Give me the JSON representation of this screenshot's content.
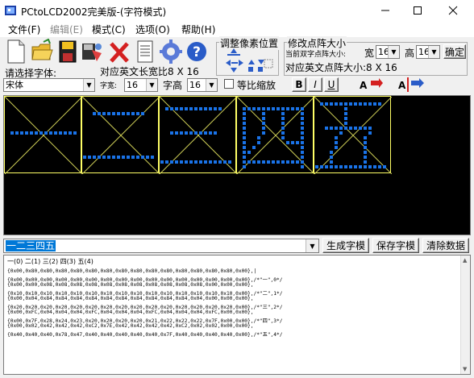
{
  "window": {
    "title": "PCtoLCD2002完美版-(字符模式)"
  },
  "menu": [
    {
      "label": "文件(F)",
      "enabled": true
    },
    {
      "label": "编辑(E)",
      "enabled": false
    },
    {
      "label": "模式(C)",
      "enabled": true
    },
    {
      "label": "选项(O)",
      "enabled": true
    },
    {
      "label": "帮助(H)",
      "enabled": true
    }
  ],
  "toolbar": {
    "pixel_group_title": "调整像素位置",
    "dot_group_title": "修改点阵大小",
    "dot_hint": "当前双字点阵大小:",
    "width_label": "宽",
    "width_value": "16",
    "height_label": "高",
    "height_value": "16",
    "confirm_label": "确定",
    "en_dot_size": "对应英文点阵大小:8 X 16"
  },
  "font_row": {
    "font_label": "请选择字体:",
    "en_width_label": "对应英文长宽比8 X 16",
    "font_value": "宋体",
    "char_width_label": "字宽:",
    "char_width_value": "16",
    "char_height_label": "字高",
    "char_height_value": "16",
    "proportional_label": "等比缩放",
    "bold_label": "B",
    "italic_label": "I",
    "underline_label": "U"
  },
  "input": {
    "text": "一二三四五",
    "generate_label": "生成字模",
    "save_label": "保存字模",
    "clear_label": "清除数据"
  },
  "output": {
    "header": "一(0) 二(1) 三(2) 四(3) 五(4)",
    "lines": [
      "{0x00,0x80,0x80,0x80,0x80,0x80,0x80,0x80,0x80,0x80,0x80,0x80,0x80,0x80,0x80,0x00},|",
      "{0x00,0x00,0x00,0x00,0x00,0x00,0x00,0x00,0x00,0x00,0x00,0x00,0x00,0x00,0x00,0x00},/*\"一\",0*/",
      "{0x00,0x00,0x08,0x08,0x08,0x08,0x08,0x08,0x08,0x08,0x08,0x08,0x08,0x00,0x00,0x00},",
      "{0x10,0x10,0x10,0x10,0x10,0x10,0x10,0x10,0x10,0x10,0x10,0x10,0x10,0x10,0x10,0x00},/*\"二\",1*/",
      "{0x00,0x04,0x84,0x84,0x84,0x84,0x84,0x84,0x84,0x84,0x84,0x84,0x04,0x00,0x00,0x00},",
      "{0x20,0x20,0x20,0x20,0x20,0x20,0x20,0x20,0x20,0x20,0x20,0x20,0x20,0x20,0x20,0x00},/*\"三\",2*/",
      "{0x00,0xFC,0x04,0x04,0x04,0xFC,0x04,0x04,0x04,0xFC,0x04,0x04,0x04,0xFC,0x00,0x00},",
      "{0x00,0x7F,0x28,0x24,0x23,0x20,0x20,0x20,0x20,0x21,0x22,0x22,0x22,0x7F,0x00,0x00},/*\"四\",3*/",
      "{0x00,0x02,0x42,0x42,0x42,0xC2,0x7E,0x42,0x42,0x42,0x42,0xC2,0x02,0x02,0x00,0x00},",
      "{0x40,0x40,0x40,0x78,0x47,0x40,0x40,0x40,0x40,0x40,0x7F,0x40,0x40,0x40,0x40,0x00},/*\"五\",4*/"
    ]
  },
  "colors": {
    "lcd_bg": "#000000",
    "pixel": "#1a73e8",
    "cell_border": "#ffff66",
    "cross": "#cccc55",
    "selection": "#0078d7"
  }
}
